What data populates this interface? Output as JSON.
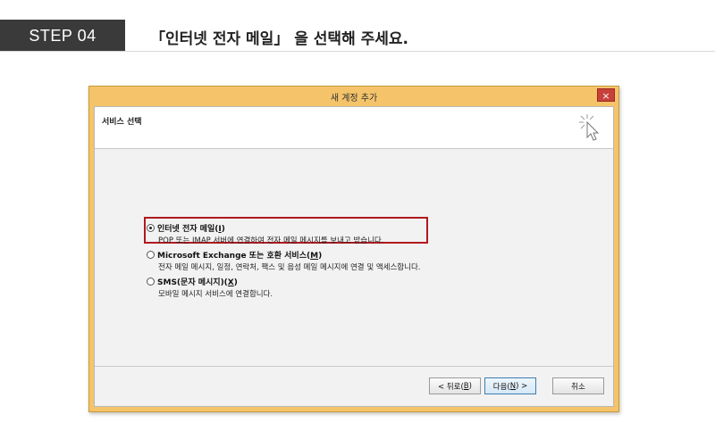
{
  "step": {
    "badge": "STEP 04",
    "title": "「인터넷 전자 메일」 을 선택해 주세요."
  },
  "window": {
    "title": "새 계정 추가",
    "close_label": "×"
  },
  "header": {
    "label": "서비스 선택",
    "icon": "wizard-cursor-icon"
  },
  "options": [
    {
      "label_text": "인터넷 전자 메일(",
      "label_key": "I",
      "label_end": ")",
      "description": "POP 또는 IMAP 서버에 연결하여 전자 메일 메시지를 보내고 받습니다.",
      "selected": true
    },
    {
      "label_text": "Microsoft Exchange 또는 호환 서비스(",
      "label_key": "M",
      "label_end": ")",
      "description": "전자 메일 메시지, 일정, 연락처, 팩스 및 음성 메일 메시지에 연결 및 액세스합니다.",
      "selected": false
    },
    {
      "label_text": "SMS(문자 메시지)(",
      "label_key": "X",
      "label_end": ")",
      "description": "모바일 메시지 서비스에 연결합니다.",
      "selected": false
    }
  ],
  "buttons": {
    "back": {
      "pre": "< 뒤로(",
      "key": "B",
      "post": ")"
    },
    "next": {
      "pre": "다음(",
      "key": "N",
      "post": ") >"
    },
    "cancel": "취소"
  },
  "colors": {
    "titlebar": "#f5c46a",
    "close": "#c7413a",
    "highlight": "#b0191e",
    "badge": "#3a3a3a"
  }
}
